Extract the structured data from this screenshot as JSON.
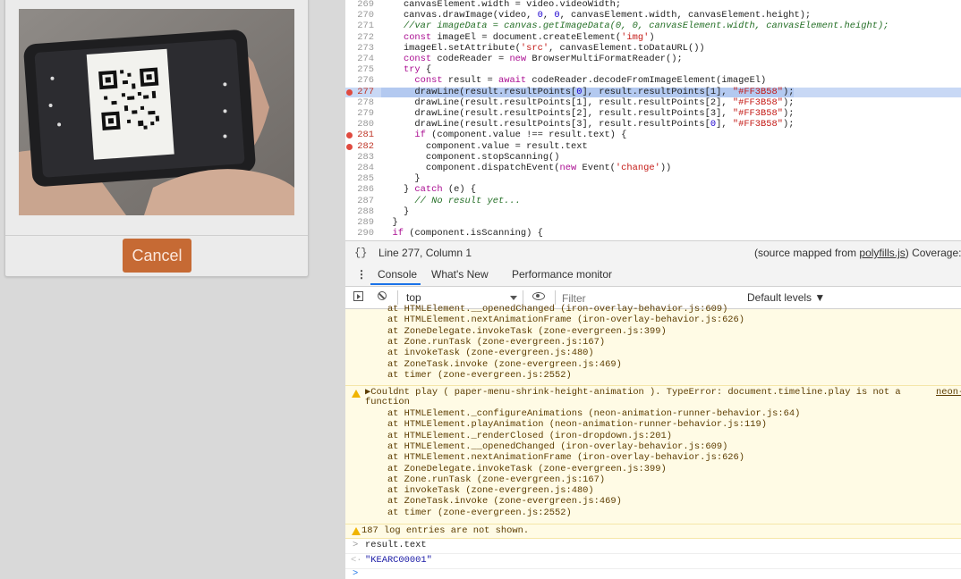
{
  "app": {
    "cancel_label": "Cancel",
    "accent_color": "#c66a34"
  },
  "editor": {
    "lines": [
      {
        "n": "269",
        "code": "    canvasElement.width = video.videoWidth;",
        "bp": false,
        "hl": false,
        "style": "plain"
      },
      {
        "n": "270",
        "code": "    canvas.drawImage(video, 0, 0, canvasElement.width, canvasElement.height);",
        "bp": false,
        "hl": false,
        "style": "plain"
      },
      {
        "n": "271",
        "code": "    //var imageData = canvas.getImageData(0, 0, canvasElement.width, canvasElement.height);",
        "bp": false,
        "hl": false,
        "style": "comment"
      },
      {
        "n": "272",
        "code": "    const imageEl = document.createElement('img')",
        "bp": false,
        "hl": false,
        "style": "plain"
      },
      {
        "n": "273",
        "code": "    imageEl.setAttribute('src', canvasElement.toDataURL())",
        "bp": false,
        "hl": false,
        "style": "plain"
      },
      {
        "n": "274",
        "code": "    const codeReader = new BrowserMultiFormatReader();",
        "bp": false,
        "hl": false,
        "style": "plain"
      },
      {
        "n": "275",
        "code": "    try {",
        "bp": false,
        "hl": false,
        "style": "plain"
      },
      {
        "n": "276",
        "code": "      const result = await codeReader.decodeFromImageElement(imageEl)",
        "bp": false,
        "hl": false,
        "style": "plain"
      },
      {
        "n": "277",
        "code": "      drawLine(result.resultPoints[0], result.resultPoints[1], \"#FF3B58\");",
        "bp": true,
        "hl": true,
        "style": "plain"
      },
      {
        "n": "278",
        "code": "      drawLine(result.resultPoints[1], result.resultPoints[2], \"#FF3B58\");",
        "bp": false,
        "hl": false,
        "style": "plain"
      },
      {
        "n": "279",
        "code": "      drawLine(result.resultPoints[2], result.resultPoints[3], \"#FF3B58\");",
        "bp": false,
        "hl": false,
        "style": "plain"
      },
      {
        "n": "280",
        "code": "      drawLine(result.resultPoints[3], result.resultPoints[0], \"#FF3B58\");",
        "bp": false,
        "hl": false,
        "style": "plain"
      },
      {
        "n": "281",
        "code": "      if (component.value !== result.text) {",
        "bp": true,
        "hl": false,
        "style": "plain"
      },
      {
        "n": "282",
        "code": "        component.value = result.text",
        "bp": true,
        "hl": false,
        "style": "plain"
      },
      {
        "n": "283",
        "code": "        component.stopScanning()",
        "bp": false,
        "hl": false,
        "style": "plain"
      },
      {
        "n": "284",
        "code": "        component.dispatchEvent(new Event('change'))",
        "bp": false,
        "hl": false,
        "style": "plain"
      },
      {
        "n": "285",
        "code": "      }",
        "bp": false,
        "hl": false,
        "style": "plain"
      },
      {
        "n": "286",
        "code": "    } catch (e) {",
        "bp": false,
        "hl": false,
        "style": "plain"
      },
      {
        "n": "287",
        "code": "      // No result yet...",
        "bp": false,
        "hl": false,
        "style": "comment"
      },
      {
        "n": "288",
        "code": "    }",
        "bp": false,
        "hl": false,
        "style": "plain"
      },
      {
        "n": "289",
        "code": "  }",
        "bp": false,
        "hl": false,
        "style": "plain"
      },
      {
        "n": "290",
        "code": "  if (component.isScanning) {",
        "bp": false,
        "hl": false,
        "style": "plain"
      }
    ]
  },
  "status": {
    "braces": "{}",
    "position": "Line 277, Column 1",
    "source_prefix": "(source mapped from ",
    "source_file": "polyfills.js",
    "source_suffix": ")  Coverage: n"
  },
  "tabs": {
    "menu": "⋮",
    "items": [
      "Console",
      "What's New",
      "Performance monitor"
    ]
  },
  "filterbar": {
    "context": "top",
    "filter_placeholder": "Filter",
    "levels": "Default levels ▼"
  },
  "console": {
    "block1": [
      "    at HTMLElement.__openedChanged (iron-overlay-behavior.js:609)",
      "    at HTMLElement.nextAnimationFrame (iron-overlay-behavior.js:626)",
      "    at ZoneDelegate.invokeTask (zone-evergreen.js:399)",
      "    at Zone.runTask (zone-evergreen.js:167)",
      "    at invokeTask (zone-evergreen.js:480)",
      "    at ZoneTask.invoke (zone-evergreen.js:469)",
      "    at timer (zone-evergreen.js:2552)"
    ],
    "warn_head": "▶Couldnt play ( paper-menu-shrink-height-animation ). TypeError: document.timeline.play is not a",
    "warn_head_right": "neon-",
    "warn_head2": "function",
    "block2": [
      "    at HTMLElement._configureAnimations (neon-animation-runner-behavior.js:64)",
      "    at HTMLElement.playAnimation (neon-animation-runner-behavior.js:119)",
      "    at HTMLElement._renderClosed (iron-dropdown.js:201)",
      "    at HTMLElement.__openedChanged (iron-overlay-behavior.js:609)",
      "    at HTMLElement.nextAnimationFrame (iron-overlay-behavior.js:626)",
      "    at ZoneDelegate.invokeTask (zone-evergreen.js:399)",
      "    at Zone.runTask (zone-evergreen.js:167)",
      "    at invokeTask (zone-evergreen.js:480)",
      "    at ZoneTask.invoke (zone-evergreen.js:469)",
      "    at timer (zone-evergreen.js:2552)"
    ],
    "hidden_entries": "187 log entries are not shown.",
    "input_line": "result.text",
    "result_line": "\"KEARC00001\"",
    "prompt": ">",
    "result_arrow": "<·"
  }
}
